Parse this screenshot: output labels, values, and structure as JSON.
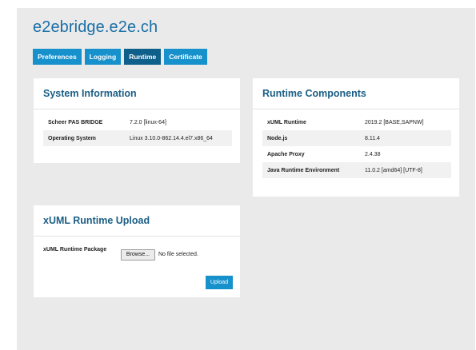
{
  "header": {
    "title": "e2ebridge.e2e.ch"
  },
  "tabs": [
    "Preferences",
    "Logging",
    "Runtime",
    "Certificate"
  ],
  "system_information": {
    "title": "System Information",
    "rows": [
      {
        "key": "Scheer PAS BRIDGE",
        "value": "7.2.0 [linux-64]"
      },
      {
        "key": "Operating System",
        "value": "Linux 3.10.0-862.14.4.el7.x86_64"
      }
    ]
  },
  "runtime_components": {
    "title": "Runtime Components",
    "rows": [
      {
        "key": "xUML Runtime",
        "value": "2019.2 [BASE,SAPNW]"
      },
      {
        "key": "Node.js",
        "value": "8.11.4"
      },
      {
        "key": "Apache Proxy",
        "value": "2.4.38"
      },
      {
        "key": "Java Runtime Environment",
        "value": "11.0.2 [amd64] [UTF-8]"
      }
    ]
  },
  "upload": {
    "title": "xUML Runtime Upload",
    "field_label": "xUML Runtime Package",
    "browse_label": "Browse...",
    "file_status": "No file selected.",
    "upload_label": "Upload"
  }
}
